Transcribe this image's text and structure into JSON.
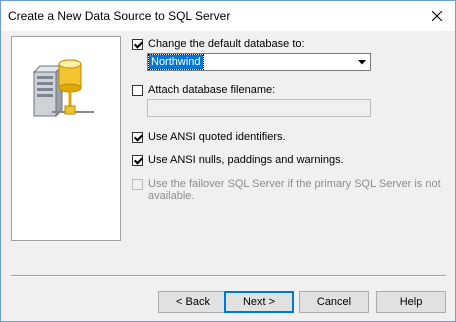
{
  "window": {
    "title": "Create a New Data Source to SQL Server"
  },
  "options": {
    "change_db": {
      "label": "Change the default database to:",
      "checked": true
    },
    "default_db_value": "Northwind",
    "attach_db": {
      "label": "Attach database filename:",
      "checked": false
    },
    "attach_db_value": "",
    "ansi_quoted": {
      "label": "Use ANSI quoted identifiers.",
      "checked": true
    },
    "ansi_nulls": {
      "label": "Use ANSI nulls, paddings and warnings.",
      "checked": true
    },
    "failover": {
      "label_line1": "Use the failover SQL Server if the primary SQL Server is not",
      "label_line2": "available.",
      "checked": false,
      "enabled": false
    }
  },
  "buttons": {
    "back": "< Back",
    "next": "Next >",
    "cancel": "Cancel",
    "help": "Help"
  },
  "icons": {
    "close": "close-icon",
    "dropdown": "chevron-down-icon",
    "illustration": "database-server-icon"
  }
}
